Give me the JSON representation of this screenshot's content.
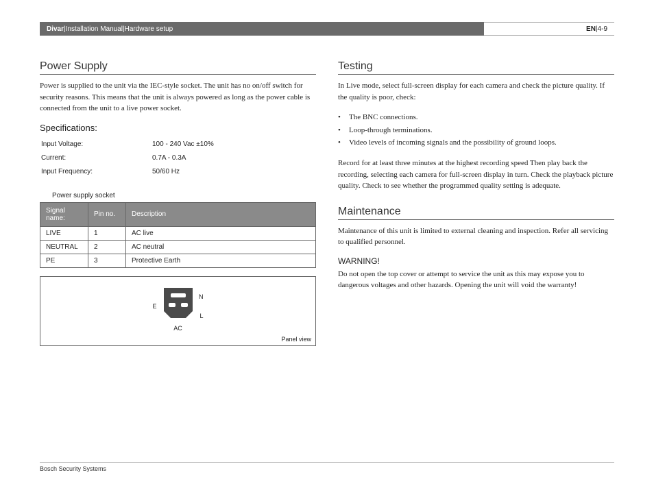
{
  "header": {
    "product": "Divar",
    "sep": " | ",
    "doc": "Installation Manual",
    "section": "Hardware setup",
    "lang": "EN",
    "page": "4-9"
  },
  "left": {
    "h_power": "Power Supply",
    "power_text": "Power is supplied to the unit via the IEC-style socket. The unit has no on/off switch for security reasons. This means that the unit is always powered as long as the power cable is connected from the unit to a live power socket.",
    "h_specs": "Specifications:",
    "specs": [
      {
        "label": "Input Voltage:",
        "value": "100 - 240 Vac ±10%"
      },
      {
        "label": "Current:",
        "value": "0.7A - 0.3A"
      },
      {
        "label": "Input Frequency:",
        "value": "50/60 Hz"
      }
    ],
    "socket_caption": "Power supply socket",
    "pin_headers": {
      "signal": "Signal name:",
      "pinno": "Pin no.",
      "desc": "Description"
    },
    "pins": [
      {
        "signal": "LIVE",
        "pinno": "1",
        "desc": "AC live"
      },
      {
        "signal": "NEUTRAL",
        "pinno": "2",
        "desc": "AC neutral"
      },
      {
        "signal": "PE",
        "pinno": "3",
        "desc": "Protective Earth"
      }
    ],
    "panel": {
      "E": "E",
      "N": "N",
      "L": "L",
      "AC": "AC",
      "panel_view": "Panel view"
    }
  },
  "right": {
    "h_testing": "Testing",
    "testing_intro": "In Live mode, select full-screen display for each camera and check the picture quality. If the quality is poor, check:",
    "bullets": [
      "The BNC connections.",
      "Loop-through terminations.",
      "Video levels of incoming signals and the possibility of ground loops."
    ],
    "testing_rec": "Record for at least three minutes at the highest recording speed Then play back the recording, selecting each camera for full-screen display in turn. Check the playback picture quality. Check to see whether the programmed quality setting is adequate.",
    "h_maint": "Maintenance",
    "maint_text": "Maintenance of this unit is limited to external cleaning and inspection. Refer all servicing to qualified personnel.",
    "h_warning": "WARNING!",
    "warning_text": "Do not open the top cover or attempt to service the unit as this may expose you to dangerous voltages and other hazards. Opening the unit will void the warranty!"
  },
  "footer": "Bosch Security Systems"
}
